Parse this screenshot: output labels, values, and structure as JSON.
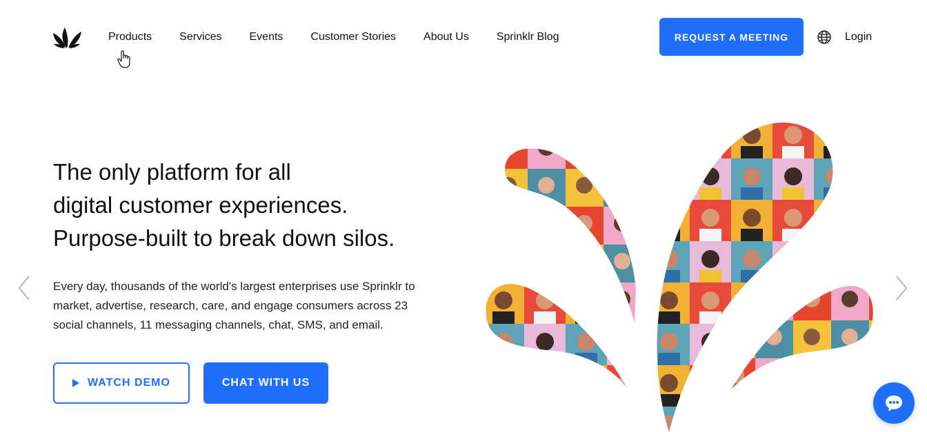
{
  "nav": {
    "links": [
      "Products",
      "Services",
      "Events",
      "Customer Stories",
      "About Us",
      "Sprinklr Blog"
    ],
    "cta": "REQUEST A MEETING",
    "login": "Login"
  },
  "hero": {
    "title_lines": [
      "The only platform for all",
      "digital customer experiences.",
      "Purpose-built to break down silos."
    ],
    "description_lines": [
      "Every day, thousands of the world's largest enterprises use Sprinklr to",
      "market, advertise, research, care, and engage consumers across 23",
      "social channels, 11 messaging channels, chat, SMS, and email."
    ],
    "watch_demo": "WATCH DEMO",
    "chat_with_us": "CHAT WITH US"
  },
  "colors": {
    "accent": "#1f6ffb",
    "text": "#111111"
  },
  "icons": {
    "logo": "sprinklr-logo",
    "globe": "globe-icon",
    "prev": "chevron-left-icon",
    "next": "chevron-right-icon",
    "chat": "chat-bubble-icon",
    "play": "play-icon"
  }
}
